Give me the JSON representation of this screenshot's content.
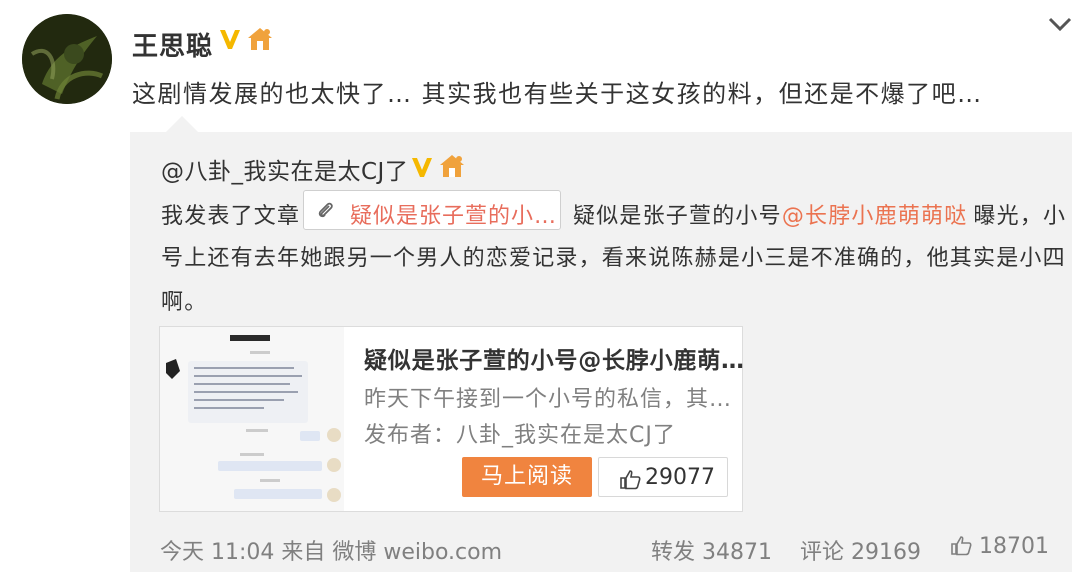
{
  "post": {
    "username": "王思聪",
    "text": "这剧情发展的也太快了… 其实我也有些关于这女孩的料，但还是不爆了吧…"
  },
  "repost": {
    "author": "@八卦_我实在是太CJ了",
    "line1_prefix": "我发表了文章",
    "article_link": "疑似是张子萱的小…",
    "line1_mid": "疑似是张子萱的小号",
    "mention": "@长脖小鹿萌萌哒",
    "line1_suffix": "曝光，小",
    "line2": "号上还有去年她跟另一个男人的恋爱记录，看来说陈赫是小三是不准确的，他其实是小四",
    "line3": "啊。"
  },
  "card": {
    "title": "疑似是张子萱的小号@长脖小鹿萌…",
    "description": "昨天下午接到一个小号的私信，其…",
    "publisher": "发布者：八卦_我实在是太CJ了",
    "read_button": "马上阅读",
    "likes": "29077"
  },
  "footer": {
    "meta": "今天 11:04 来自 微博 weibo.com",
    "reposts": "转发 34871",
    "comments": "评论 29169",
    "likes": "18701"
  },
  "colors": {
    "accent_orange": "#f0843f",
    "mention": "#eb7350",
    "verified_gold": "#f5b800"
  },
  "icons": [
    "verified-v-icon",
    "house-icon",
    "chevron-down-icon",
    "paperclip-icon",
    "thumbs-up-icon"
  ]
}
